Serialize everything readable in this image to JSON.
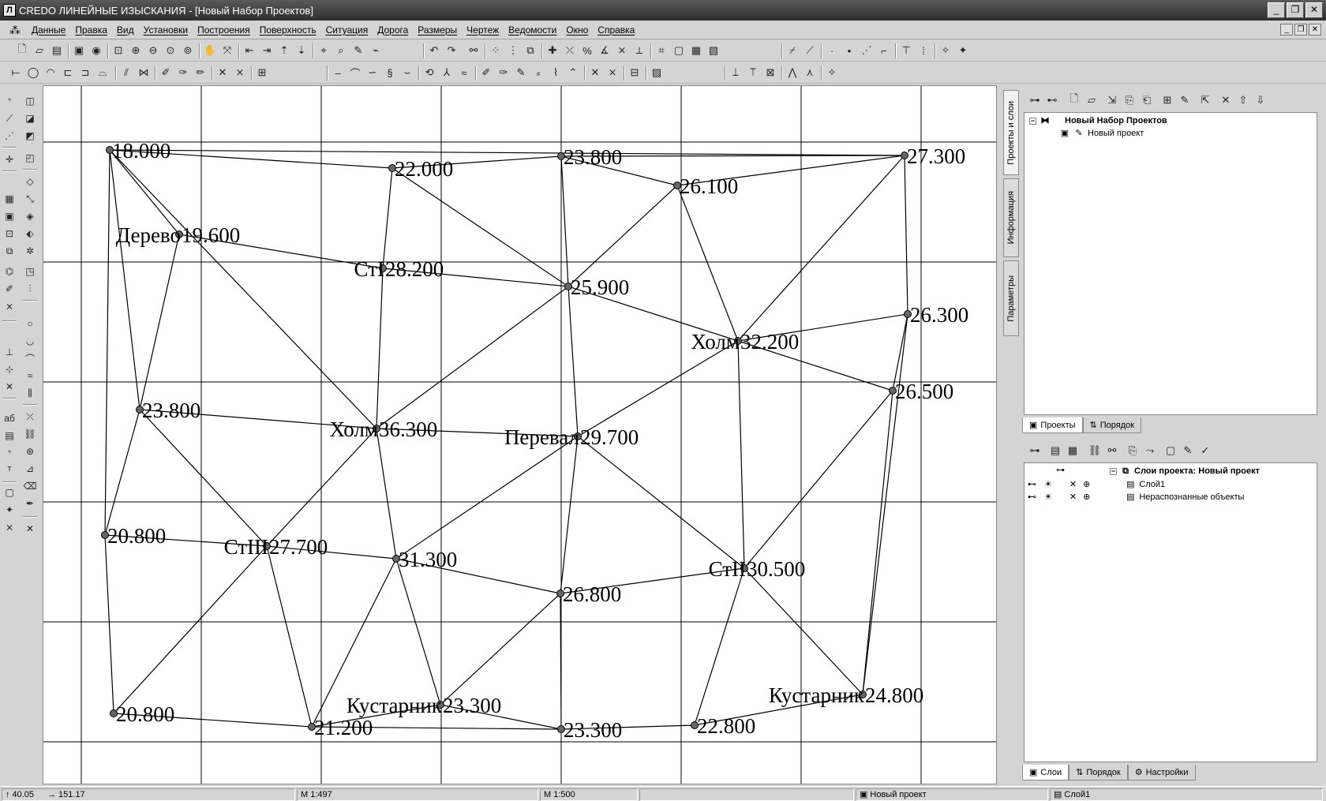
{
  "window": {
    "title": "CREDO ЛИНЕЙНЫЕ ИЗЫСКАНИЯ - [Новый Набор Проектов]",
    "app_icon": "Л",
    "controls": [
      "_",
      "❐",
      "✕"
    ]
  },
  "menu": {
    "items": [
      "Данные",
      "Правка",
      "Вид",
      "Установки",
      "Построения",
      "Поверхность",
      "Ситуация",
      "Дорога",
      "Размеры",
      "Чертеж",
      "Ведомости",
      "Окно",
      "Справка"
    ],
    "mdi_controls": [
      "_",
      "❐",
      "✕"
    ]
  },
  "canvas": {
    "points": [
      {
        "id": "p1",
        "value": "18.000",
        "prefix": ""
      },
      {
        "id": "p2",
        "value": "22.000",
        "prefix": ""
      },
      {
        "id": "p3",
        "value": "23.800",
        "prefix": ""
      },
      {
        "id": "p4",
        "value": "26.100",
        "prefix": ""
      },
      {
        "id": "p5",
        "value": "27.300",
        "prefix": ""
      },
      {
        "id": "p6",
        "value": "19.600",
        "prefix": "Дерево"
      },
      {
        "id": "p7",
        "value": "28.200",
        "prefix": "СтI"
      },
      {
        "id": "p8",
        "value": "25.900",
        "prefix": ""
      },
      {
        "id": "p9",
        "value": "32.200",
        "prefix": "Холм"
      },
      {
        "id": "p10",
        "value": "26.300",
        "prefix": ""
      },
      {
        "id": "p11",
        "value": "26.500",
        "prefix": ""
      },
      {
        "id": "p12",
        "value": "23.800",
        "prefix": ""
      },
      {
        "id": "p13",
        "value": "36.300",
        "prefix": "Холм"
      },
      {
        "id": "p14",
        "value": "29.700",
        "prefix": "Перевал"
      },
      {
        "id": "p15",
        "value": "20.800",
        "prefix": ""
      },
      {
        "id": "p16",
        "value": "27.700",
        "prefix": "СтIII"
      },
      {
        "id": "p17",
        "value": "31.300",
        "prefix": ""
      },
      {
        "id": "p18",
        "value": "26.800",
        "prefix": ""
      },
      {
        "id": "p19",
        "value": "30.500",
        "prefix": "СтII"
      },
      {
        "id": "p20",
        "value": "20.800",
        "prefix": ""
      },
      {
        "id": "p21",
        "value": "21.200",
        "prefix": ""
      },
      {
        "id": "p22",
        "value": "23.300",
        "prefix": "Кустарник"
      },
      {
        "id": "p23",
        "value": "23.300",
        "prefix": ""
      },
      {
        "id": "p24",
        "value": "22.800",
        "prefix": ""
      },
      {
        "id": "p25",
        "value": "24.800",
        "prefix": "Кустарник"
      }
    ],
    "edges": [
      [
        "p1",
        "p5"
      ],
      [
        "p1",
        "p2"
      ],
      [
        "p2",
        "p3"
      ],
      [
        "p3",
        "p5"
      ],
      [
        "p3",
        "p4"
      ],
      [
        "p4",
        "p5"
      ],
      [
        "p1",
        "p6"
      ],
      [
        "p1",
        "p12"
      ],
      [
        "p1",
        "p15"
      ],
      [
        "p1",
        "p13"
      ],
      [
        "p6",
        "p7"
      ],
      [
        "p2",
        "p7"
      ],
      [
        "p2",
        "p8"
      ],
      [
        "p3",
        "p8"
      ],
      [
        "p4",
        "p8"
      ],
      [
        "p4",
        "p9"
      ],
      [
        "p5",
        "p9"
      ],
      [
        "p5",
        "p10"
      ],
      [
        "p7",
        "p8"
      ],
      [
        "p7",
        "p13"
      ],
      [
        "p8",
        "p9"
      ],
      [
        "p8",
        "p13"
      ],
      [
        "p8",
        "p14"
      ],
      [
        "p9",
        "p10"
      ],
      [
        "p9",
        "p11"
      ],
      [
        "p9",
        "p14"
      ],
      [
        "p9",
        "p19"
      ],
      [
        "p10",
        "p11"
      ],
      [
        "p10",
        "p25"
      ],
      [
        "p6",
        "p12"
      ],
      [
        "p12",
        "p13"
      ],
      [
        "p12",
        "p16"
      ],
      [
        "p12",
        "p15"
      ],
      [
        "p13",
        "p14"
      ],
      [
        "p13",
        "p16"
      ],
      [
        "p13",
        "p17"
      ],
      [
        "p14",
        "p17"
      ],
      [
        "p14",
        "p19"
      ],
      [
        "p14",
        "p18"
      ],
      [
        "p15",
        "p16"
      ],
      [
        "p15",
        "p20"
      ],
      [
        "p16",
        "p17"
      ],
      [
        "p16",
        "p20"
      ],
      [
        "p16",
        "p21"
      ],
      [
        "p17",
        "p18"
      ],
      [
        "p17",
        "p21"
      ],
      [
        "p17",
        "p22"
      ],
      [
        "p18",
        "p19"
      ],
      [
        "p18",
        "p22"
      ],
      [
        "p18",
        "p23"
      ],
      [
        "p19",
        "p24"
      ],
      [
        "p19",
        "p25"
      ],
      [
        "p19",
        "p11"
      ],
      [
        "p11",
        "p25"
      ],
      [
        "p20",
        "p21"
      ],
      [
        "p21",
        "p22"
      ],
      [
        "p21",
        "p23"
      ],
      [
        "p22",
        "p23"
      ],
      [
        "p23",
        "p24"
      ],
      [
        "p24",
        "p25"
      ]
    ]
  },
  "side_tabs": [
    "Проекты и слои",
    "Информация",
    "Параметры"
  ],
  "projects_panel": {
    "root": "Новый Набор Проектов",
    "child": "Новый проект",
    "tabs": [
      "Проекты",
      "Порядок"
    ]
  },
  "layers_panel": {
    "root": "Слои проекта: Новый проект",
    "layers": [
      "Слой1",
      "Нераспознанные объекты"
    ],
    "tabs": [
      "Слои",
      "Порядок",
      "Настройки"
    ]
  },
  "status": {
    "coord_x": "40.05",
    "coord_y": "151.17",
    "scale1": "М 1:497",
    "scale2": "М 1:500",
    "project": "Новый проект",
    "layer": "Слой1"
  }
}
